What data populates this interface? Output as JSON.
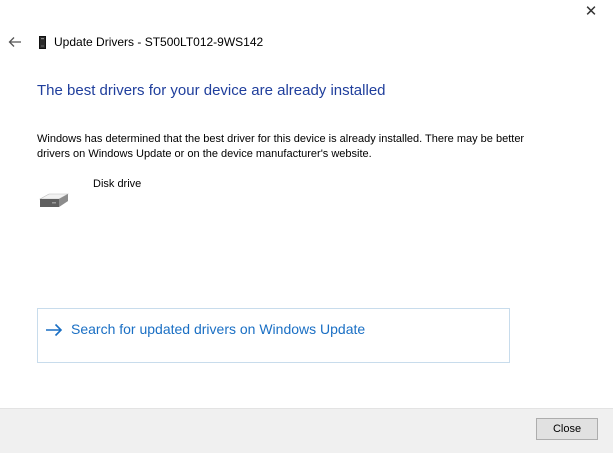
{
  "window": {
    "close_glyph": "✕",
    "title": "Update Drivers - ST500LT012-9WS142"
  },
  "heading": "The best drivers for your device are already installed",
  "description": "Windows has determined that the best driver for this device is already installed. There may be better drivers on Windows Update or on the device manufacturer's website.",
  "device": {
    "name": "Disk drive",
    "icon": "disk-drive-icon"
  },
  "update_link": {
    "label": "Search for updated drivers on Windows Update",
    "icon": "arrow-right-icon"
  },
  "footer": {
    "close_label": "Close"
  },
  "colors": {
    "heading": "#1f3e9c",
    "link": "#1a6fc4",
    "link_border": "#c8dcec",
    "footer_bg": "#f0f0f0",
    "button_bg": "#e1e1e1"
  }
}
